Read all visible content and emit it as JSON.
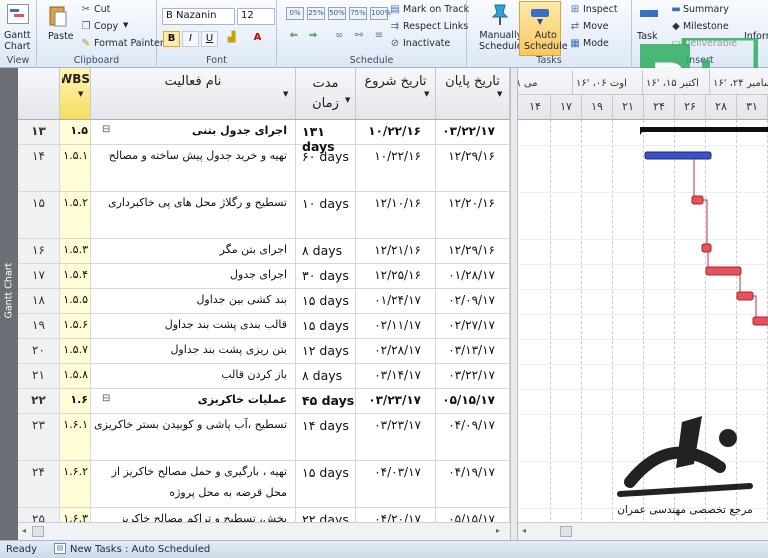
{
  "ribbon": {
    "view": {
      "button": "Gantt\nChart",
      "label": "View"
    },
    "clipboard": {
      "paste": "Paste",
      "cut": "Cut",
      "copy": "Copy",
      "format_painter": "Format Painter",
      "label": "Clipboard"
    },
    "font": {
      "family": "B Nazanin",
      "size": "12",
      "bold": "B",
      "italic": "I",
      "underline": "U",
      "color_a": "A",
      "label": "Font"
    },
    "schedule": {
      "pct": [
        "0%",
        "25%",
        "50%",
        "75%",
        "100%"
      ],
      "mark_on_track": "Mark on Track",
      "respect_links": "Respect Links",
      "inactivate": "Inactivate",
      "label": "Schedule"
    },
    "tasks": {
      "manually": "Manually\nSchedule",
      "auto": "Auto\nSchedule",
      "inspect": "Inspect",
      "move": "Move",
      "mode": "Mode",
      "label": "Tasks"
    },
    "insert": {
      "task": "Task",
      "summary": "Summary",
      "milestone": "Milestone",
      "deliverable": "Deliverable",
      "label": "Insert",
      "information": "Inform"
    }
  },
  "sidebar_label": "Gantt Chart",
  "columns": {
    "wbs": "WBS",
    "name": "نام فعالیت",
    "duration": "مدت زمان",
    "start": "تاریخ شروع",
    "finish": "تاریخ پایان"
  },
  "rows": [
    {
      "id": "۱۳",
      "wbs": "۱.۵",
      "name": "اجرای جدول بتنی",
      "duration": "۱۳۱ days",
      "start": "۱۰/۲۲/۱۶",
      "finish": "۰۳/۲۲/۱۷",
      "summary": true
    },
    {
      "id": "۱۴",
      "wbs": "۱.۵.۱",
      "name": "تهیه و خرید جدول پیش ساخته و مصالح",
      "duration": "۶۰ days",
      "start": "۱۰/۲۲/۱۶",
      "finish": "۱۲/۲۹/۱۶",
      "summary": false
    },
    {
      "id": "۱۵",
      "wbs": "۱.۵.۲",
      "name": "تسطیح و رگلاژ محل های پی خاکبرداری",
      "duration": "۱۰ days",
      "start": "۱۲/۱۰/۱۶",
      "finish": "۱۲/۲۰/۱۶",
      "summary": false
    },
    {
      "id": "۱۶",
      "wbs": "۱.۵.۳",
      "name": "اجرای بتن مگر",
      "duration": "۸ days",
      "start": "۱۲/۲۱/۱۶",
      "finish": "۱۲/۲۹/۱۶",
      "summary": false
    },
    {
      "id": "۱۷",
      "wbs": "۱.۵.۴",
      "name": "اجرای جدول",
      "duration": "۳۰ days",
      "start": "۱۲/۲۵/۱۶",
      "finish": "۰۱/۲۸/۱۷",
      "summary": false
    },
    {
      "id": "۱۸",
      "wbs": "۱.۵.۵",
      "name": "بند کشی بین جداول",
      "duration": "۱۵ days",
      "start": "۰۱/۲۴/۱۷",
      "finish": "۰۲/۰۹/۱۷",
      "summary": false
    },
    {
      "id": "۱۹",
      "wbs": "۱.۵.۶",
      "name": "قالب بندی پشت بند جداول",
      "duration": "۱۵ days",
      "start": "۰۲/۱۱/۱۷",
      "finish": "۰۲/۲۷/۱۷",
      "summary": false
    },
    {
      "id": "۲۰",
      "wbs": "۱.۵.۷",
      "name": "بتن ریزی پشت بند جداول",
      "duration": "۱۲ days",
      "start": "۰۲/۲۸/۱۷",
      "finish": "۰۳/۱۳/۱۷",
      "summary": false
    },
    {
      "id": "۲۱",
      "wbs": "۱.۵.۸",
      "name": "باز کردن قالب",
      "duration": "۸ days",
      "start": "۰۳/۱۴/۱۷",
      "finish": "۰۳/۲۲/۱۷",
      "summary": false
    },
    {
      "id": "۲۲",
      "wbs": "۱.۶",
      "name": "عملیات خاکریزی",
      "duration": "۴۵ days",
      "start": "۰۳/۲۳/۱۷",
      "finish": "۰۵/۱۵/۱۷",
      "summary": true
    },
    {
      "id": "۲۳",
      "wbs": "۱.۶.۱",
      "name": "تسطیح ،آب پاشی و کوبیدن بستر خاکریزی",
      "duration": "۱۴ days",
      "start": "۰۳/۲۳/۱۷",
      "finish": "۰۴/۰۹/۱۷",
      "summary": false
    },
    {
      "id": "۲۴",
      "wbs": "۱.۶.۲",
      "name": "تهیه ، بارگیری و حمل مصالح خاکریز از محل قرضه به محل پروژه",
      "duration": "۱۵ days",
      "start": "۰۴/۰۳/۱۷",
      "finish": "۰۴/۱۹/۱۷",
      "summary": false
    },
    {
      "id": "۲۵",
      "wbs": "۱.۶.۳",
      "name": "پخش، تسطیح و تراکم مصالح خاکریز",
      "duration": "۲۲ days",
      "start": "۰۴/۲۰/۱۷",
      "finish": "۰۵/۱۵/۱۷",
      "summary": false
    }
  ],
  "timescale": {
    "major": [
      "می ۲۸، '۱۶",
      "اوت ۰۶، '۱۶",
      "اکتبر ۱۵، '۱۶",
      "دسامبر ۲۴، '۱۶"
    ],
    "minor": [
      "۱۴",
      "۱۷",
      "۱۹",
      "۲۱",
      "۲۴",
      "۲۶",
      "۲۸",
      "۳۱"
    ]
  },
  "status": {
    "ready": "Ready",
    "new_tasks": "New Tasks : Auto Scheduled"
  },
  "watermark": {
    "text": "مرجع تخصصی مهندسی عمران"
  },
  "colors": {
    "summary_bar": "#111111",
    "normal_bar": "#3a4fc9",
    "critical_bar": "#e8505b",
    "wbs_column": "#fffcd6",
    "project_logo": "#2fae5f"
  }
}
